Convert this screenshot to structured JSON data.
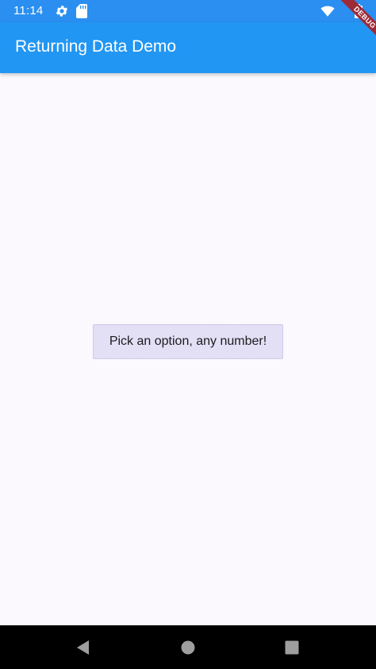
{
  "status_bar": {
    "time": "11:14",
    "icons": [
      "gear-icon",
      "sd-card-icon",
      "wifi-icon",
      "battery-icon"
    ],
    "color": "#2a8ff0"
  },
  "app_bar": {
    "title": "Returning Data Demo",
    "color": "#2196f3"
  },
  "debug_banner": {
    "label": "DEBUG",
    "color": "#9e2a37"
  },
  "main": {
    "button_label": "Pick an option, any number!",
    "button_color": "#e3e0f5",
    "background": "#fbf9fe"
  },
  "nav_bar": {
    "icons": [
      "back-icon",
      "home-icon",
      "recents-icon"
    ]
  }
}
